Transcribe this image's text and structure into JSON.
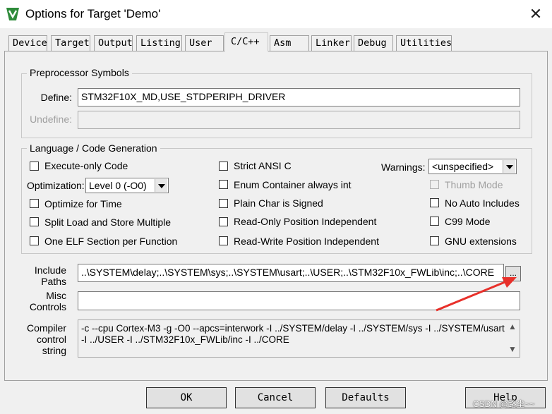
{
  "window": {
    "title": "Options for Target 'Demo'",
    "close_glyph": "✕"
  },
  "tabs": [
    "Device",
    "Target",
    "Output",
    "Listing",
    "User",
    "C/C++",
    "Asm",
    "Linker",
    "Debug",
    "Utilities"
  ],
  "active_tab": "C/C++",
  "preprocessor": {
    "legend": "Preprocessor Symbols",
    "define_label": "Define:",
    "define_value": "STM32F10X_MD,USE_STDPERIPH_DRIVER",
    "undefine_label": "Undefine:",
    "undefine_value": ""
  },
  "language": {
    "legend": "Language / Code Generation",
    "execute_only": "Execute-only Code",
    "optimization_label": "Optimization:",
    "optimization_value": "Level 0 (-O0)",
    "optimize_time": "Optimize for Time",
    "split_load": "Split Load and Store Multiple",
    "one_elf": "One ELF Section per Function",
    "strict_ansi": "Strict ANSI C",
    "enum_container": "Enum Container always int",
    "plain_char": "Plain Char is Signed",
    "ro_pi": "Read-Only Position Independent",
    "rw_pi": "Read-Write Position Independent",
    "warnings_label": "Warnings:",
    "warnings_value": "<unspecified>",
    "thumb_mode": "Thumb Mode",
    "no_auto_includes": "No Auto Includes",
    "c99_mode": "C99 Mode",
    "gnu_ext": "GNU extensions"
  },
  "include": {
    "label_line1": "Include",
    "label_line2": "Paths",
    "value": "..\\SYSTEM\\delay;..\\SYSTEM\\sys;..\\SYSTEM\\usart;..\\USER;..\\STM32F10x_FWLib\\inc;..\\CORE",
    "browse": "..."
  },
  "misc": {
    "label_line1": "Misc",
    "label_line2": "Controls",
    "value": ""
  },
  "compiler": {
    "label_line1": "Compiler",
    "label_line2": "control",
    "label_line3": "string",
    "line1": "-c --cpu Cortex-M3 -g -O0 --apcs=interwork -I ../SYSTEM/delay -I ../SYSTEM/sys -I ../SYSTEM/usart",
    "line2": "-I ../USER -I ../STM32F10x_FWLib/inc -I ../CORE"
  },
  "buttons": {
    "ok": "OK",
    "cancel": "Cancel",
    "defaults": "Defaults",
    "help": "Help"
  },
  "watermark": "CSDN @路尘~~",
  "colors": {
    "annotation_arrow": "#e8302a",
    "app_icon_green": "#2e8b3a"
  }
}
